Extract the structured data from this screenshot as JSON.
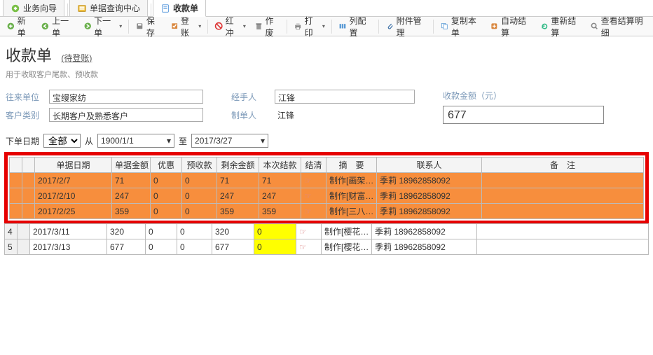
{
  "tabs": [
    {
      "label": "业务向导",
      "active": false
    },
    {
      "label": "单据查询中心",
      "active": false
    },
    {
      "label": "收款单",
      "active": true
    }
  ],
  "toolbar": {
    "new": "新单",
    "prev": "上一单",
    "next": "下一单",
    "save": "保存",
    "post": "登账",
    "redoff": "红冲",
    "void": "作废",
    "print": "打印",
    "colcfg": "列配置",
    "attach": "附件管理",
    "copy": "复制本单",
    "autoset": "自动结算",
    "reset": "重新结算",
    "viewdet": "查看结算明细"
  },
  "title": {
    "main": "收款单",
    "status": "(待登账)",
    "sub": "用于收取客户尾款、预收款"
  },
  "form": {
    "unit_label": "往来单位",
    "unit_value": "宝缦家纺",
    "cat_label": "客户类别",
    "cat_value": "长期客户及熟悉客户",
    "handler_label": "经手人",
    "handler_value": "江锋",
    "maker_label": "制单人",
    "maker_value": "江锋",
    "amount_label": "收款金额（元）",
    "amount_value": "677"
  },
  "filter": {
    "date_label": "下单日期",
    "range_sel": "全部",
    "from_label": "从",
    "from_value": "1900/1/1",
    "to_label": "至",
    "to_value": "2017/3/27"
  },
  "grid": {
    "headers": {
      "date": "单据日期",
      "amount": "单据金额",
      "discount": "优惠",
      "prepay": "预收款",
      "remain": "剩余金额",
      "thispay": "本次结款",
      "settle": "结清",
      "summary": "摘　要",
      "contact": "联系人",
      "note": "备　注"
    },
    "rows": [
      {
        "num": "",
        "hl": "orange",
        "date": "2017/2/7",
        "amount": "71",
        "discount": "0",
        "prepay": "0",
        "remain": "71",
        "thispay": "71",
        "thishl": false,
        "hand": true,
        "summary": "制作[画架…",
        "contact": "季莉 18962858092",
        "note": ""
      },
      {
        "num": "",
        "hl": "orange",
        "date": "2017/2/10",
        "amount": "247",
        "discount": "0",
        "prepay": "0",
        "remain": "247",
        "thispay": "247",
        "thishl": false,
        "hand": true,
        "summary": "制作[财富…",
        "contact": "季莉 18962858092",
        "note": ""
      },
      {
        "num": "",
        "hl": "orange",
        "date": "2017/2/25",
        "amount": "359",
        "discount": "0",
        "prepay": "0",
        "remain": "359",
        "thispay": "359",
        "thishl": false,
        "hand": true,
        "summary": "制作[三八…",
        "contact": "季莉 18962858092",
        "note": ""
      },
      {
        "num": "4",
        "hl": "",
        "date": "2017/3/11",
        "amount": "320",
        "discount": "0",
        "prepay": "0",
        "remain": "320",
        "thispay": "0",
        "thishl": true,
        "hand": true,
        "summary": "制作[樱花…",
        "contact": "季莉 18962858092",
        "note": ""
      },
      {
        "num": "5",
        "hl": "",
        "date": "2017/3/13",
        "amount": "677",
        "discount": "0",
        "prepay": "0",
        "remain": "677",
        "thispay": "0",
        "thishl": true,
        "hand": true,
        "summary": "制作[樱花…",
        "contact": "季莉 18962858092",
        "note": ""
      }
    ]
  },
  "icons": {
    "hand": "☞",
    "dd": "▾"
  }
}
